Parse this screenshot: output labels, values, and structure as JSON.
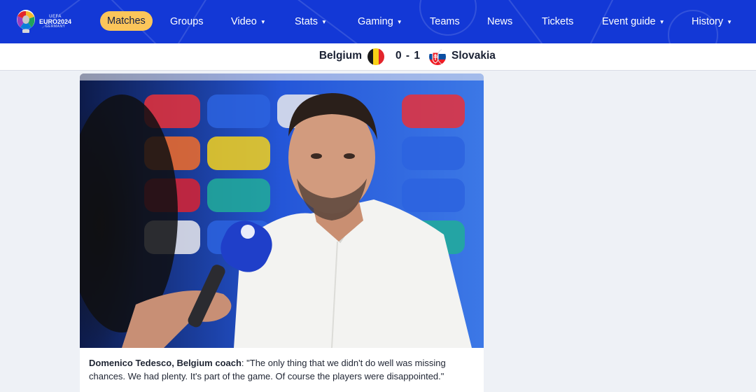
{
  "logo": {
    "uefa": "UEFA",
    "euro": "EURO2024",
    "country": "GERMANY"
  },
  "nav": [
    {
      "label": "Matches",
      "active": true,
      "dropdown": false
    },
    {
      "label": "Groups",
      "dropdown": false
    },
    {
      "label": "Video",
      "dropdown": true
    },
    {
      "label": "Stats",
      "dropdown": true
    },
    {
      "label": "Gaming",
      "dropdown": true
    },
    {
      "label": "Teams",
      "dropdown": false
    },
    {
      "label": "News",
      "dropdown": false
    },
    {
      "label": "Tickets",
      "dropdown": false
    },
    {
      "label": "Event guide",
      "dropdown": true
    },
    {
      "label": "History",
      "dropdown": true
    }
  ],
  "caret": "▼",
  "match": {
    "home": "Belgium",
    "score": "0 - 1",
    "away": "Slovakia"
  },
  "colors": {
    "nav_bg": "#1338d6",
    "active_pill": "#fbc55a",
    "page_bg": "#eef1f6"
  },
  "article": {
    "caption_name": "Domenico Tedesco, Belgium coach",
    "caption_quote": ": \"The only thing that we didn't do well was missing chances. We had plenty. It's part of the game. Of course the players were disappointed.\""
  }
}
